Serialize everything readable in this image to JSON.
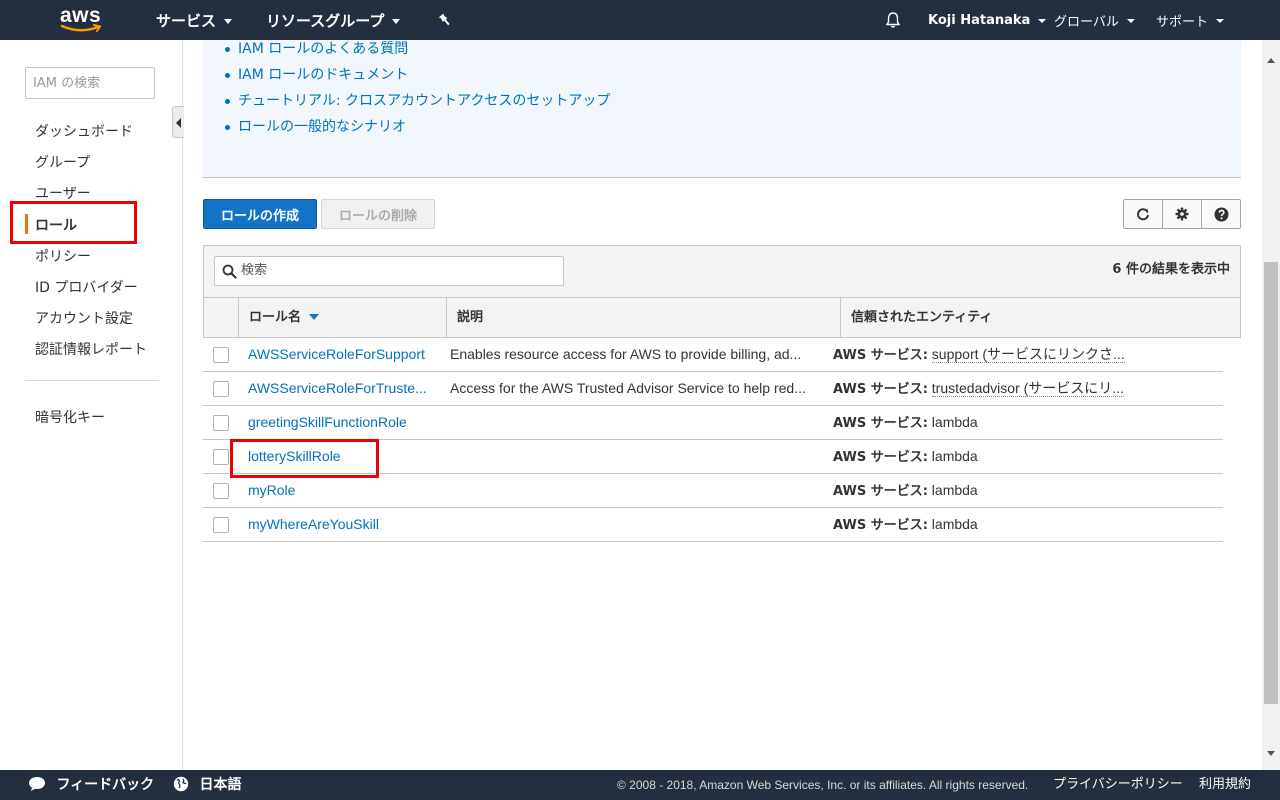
{
  "topnav": {
    "logo_text": "aws",
    "services": "サービス",
    "resource_groups": "リソースグループ",
    "pin_icon": "pin-icon",
    "bell_icon": "bell-icon",
    "user": "Koji Hatanaka",
    "region": "グローバル",
    "support": "サポート"
  },
  "sidebar": {
    "search_placeholder": "IAM の検索",
    "items": [
      {
        "label": "ダッシュボード"
      },
      {
        "label": "グループ"
      },
      {
        "label": "ユーザー"
      },
      {
        "label": "ロール",
        "active": true
      },
      {
        "label": "ポリシー"
      },
      {
        "label": "ID プロバイダー"
      },
      {
        "label": "アカウント設定"
      },
      {
        "label": "認証情報レポート"
      }
    ],
    "encryption_keys": "暗号化キー"
  },
  "info": {
    "links": [
      "IAM ロールのよくある質問",
      "IAM ロールのドキュメント",
      "チュートリアル: クロスアカウントアクセスのセットアップ",
      "ロールの一般的なシナリオ"
    ]
  },
  "actions": {
    "create_role": "ロールの作成",
    "delete_role": "ロールの削除",
    "refresh_icon": "refresh-icon",
    "settings_icon": "gear-icon",
    "help_icon": "help-icon"
  },
  "table": {
    "search_placeholder": "検索",
    "result_count": "6 件の結果を表示中",
    "columns": {
      "name": "ロール名",
      "description": "説明",
      "trusted_entity": "信頼されたエンティティ"
    },
    "rows": [
      {
        "name": "AWSServiceRoleForSupport",
        "description": "Enables resource access for AWS to provide billing, ad...",
        "entity_prefix": "AWS サービス:",
        "entity": "support (サービスにリンクさ..."
      },
      {
        "name": "AWSServiceRoleForTruste...",
        "description": "Access for the AWS Trusted Advisor Service to help red...",
        "entity_prefix": "AWS サービス:",
        "entity": "trustedadvisor (サービスにリ..."
      },
      {
        "name": "greetingSkillFunctionRole",
        "description": "",
        "entity_prefix": "AWS サービス:",
        "entity": "lambda"
      },
      {
        "name": "lotterySkillRole",
        "description": "",
        "entity_prefix": "AWS サービス:",
        "entity": "lambda"
      },
      {
        "name": "myRole",
        "description": "",
        "entity_prefix": "AWS サービス:",
        "entity": "lambda"
      },
      {
        "name": "myWhereAreYouSkill",
        "description": "",
        "entity_prefix": "AWS サービス:",
        "entity": "lambda"
      }
    ]
  },
  "footer": {
    "feedback": "フィードバック",
    "language": "日本語",
    "copyright": "© 2008 - 2018, Amazon Web Services, Inc. or its affiliates. All rights reserved.",
    "privacy": "プライバシーポリシー",
    "terms": "利用規約"
  }
}
